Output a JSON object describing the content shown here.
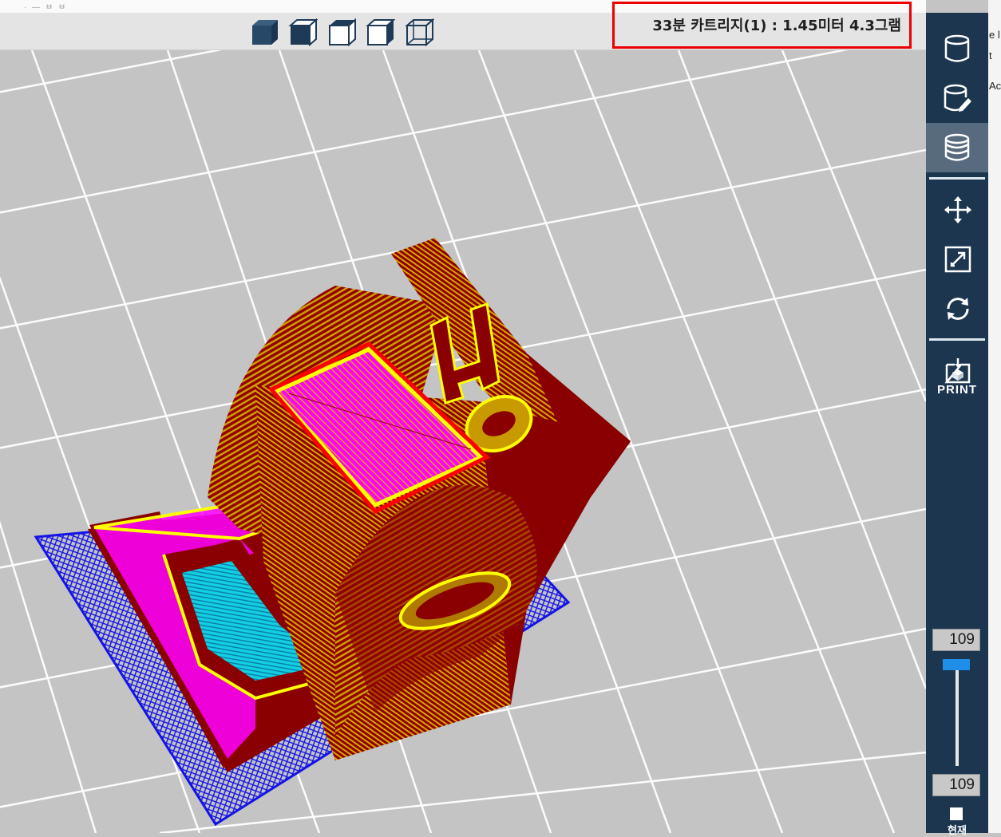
{
  "window": {
    "title_fragment": "· — ㅂ ㅂ"
  },
  "toolbar": {
    "view_buttons": [
      {
        "name": "view-solid-icon"
      },
      {
        "name": "view-front-icon"
      },
      {
        "name": "view-top-icon"
      },
      {
        "name": "view-side-icon"
      },
      {
        "name": "view-wireframe-icon"
      }
    ],
    "status_text": "33분  카트리지(1) : 1.45미터 4.3그램",
    "highlight_color": "#ee0000"
  },
  "viewport": {
    "background_color": "#c4c4c4",
    "grid_color": "#ffffff",
    "model_colors": {
      "wall": "#8a0000",
      "infill": "#c89a00",
      "top_skin": "#ff00ff",
      "perimeter": "#ffff00",
      "support": "#00c8d8",
      "raft": "#1414e6",
      "highlight": "#ff0000"
    }
  },
  "sidebar": {
    "background_color": "#1c3650",
    "buttons": [
      {
        "name": "model-icon",
        "active": false
      },
      {
        "name": "edit-model-icon",
        "active": false
      },
      {
        "name": "layers-icon",
        "active": true
      },
      {
        "name": "move-icon",
        "active": false
      },
      {
        "name": "scale-icon",
        "active": false
      },
      {
        "name": "rotate-icon",
        "active": false
      },
      {
        "name": "print-icon",
        "active": false
      }
    ],
    "print_label": "PRINT",
    "layer_top": "109",
    "layer_bottom": "109",
    "current_label": "현재",
    "slider_color": "#1e8ee8"
  },
  "right_edge": {
    "fragments": [
      "e l",
      "t",
      "Ac"
    ]
  }
}
